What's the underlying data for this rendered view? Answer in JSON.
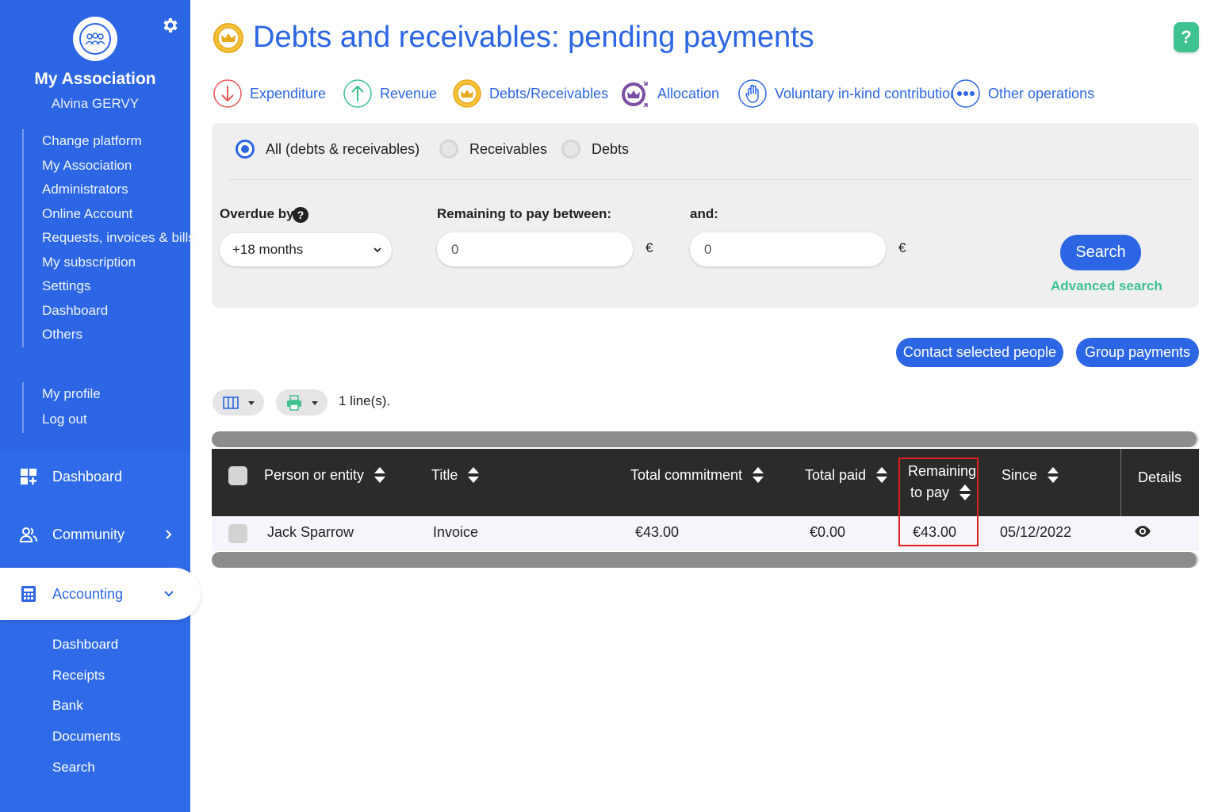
{
  "sidebar": {
    "association_name": "My Association",
    "user_name": "Alvina GERVY",
    "menu": [
      "Change platform",
      "My Association",
      "Administrators",
      "Online Account",
      "Requests, invoices & bills",
      "My subscription",
      "Settings",
      "Dashboard",
      "Others"
    ],
    "account_menu": [
      "My profile",
      "Log out"
    ],
    "nav": {
      "dashboard": "Dashboard",
      "community": "Community",
      "accounting": "Accounting"
    },
    "accounting_sub": [
      "Dashboard",
      "Receipts",
      "Bank",
      "Documents",
      "Search"
    ]
  },
  "page": {
    "title": "Debts and receivables: pending payments",
    "help": "?"
  },
  "operations": [
    "Expenditure",
    "Revenue",
    "Debts/Receivables",
    "Allocation",
    "Voluntary in-kind contribution",
    "Other operations"
  ],
  "filters": {
    "radios": [
      {
        "label": "All (debts & receivables)",
        "selected": true
      },
      {
        "label": "Receivables",
        "selected": false
      },
      {
        "label": "Debts",
        "selected": false
      }
    ],
    "overdue_label": "Overdue by",
    "overdue_value": "+18 months",
    "remaining_label": "Remaining to pay between:",
    "remaining_min": "0",
    "and_label": "and:",
    "remaining_max": "0",
    "currency": "€",
    "search_label": "Search",
    "advanced_search_label": "Advanced search"
  },
  "actions": {
    "contact_label": "Contact selected people",
    "group_label": "Group payments"
  },
  "toolbar": {
    "lines_count": "1 line(s)."
  },
  "table": {
    "columns": {
      "person": "Person or entity",
      "title": "Title",
      "total_commitment": "Total commitment",
      "total_paid": "Total paid",
      "remaining_line1": "Remaining",
      "remaining_line2": "to pay",
      "since": "Since",
      "details": "Details"
    },
    "rows": [
      {
        "person": "Jack Sparrow",
        "title": "Invoice",
        "total_commitment": "€43.00",
        "total_paid": "€0.00",
        "remaining": "€43.00",
        "since": "05/12/2022"
      }
    ]
  },
  "colors": {
    "primary": "#2c66e4",
    "accent_green": "#3ec28f",
    "highlight": "#e02020"
  }
}
